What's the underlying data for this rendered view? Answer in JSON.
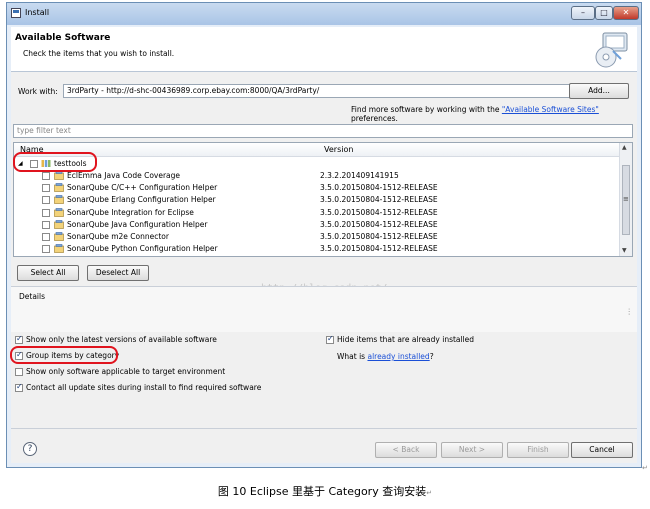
{
  "window": {
    "title": "Install",
    "min_glyph": "–",
    "max_glyph": "□",
    "close_glyph": "✕"
  },
  "header": {
    "title": "Available Software",
    "subtitle": "Check the items that you wish to install."
  },
  "work_with": {
    "label": "Work with:",
    "value": "3rdParty - http://d-shc-00436989.corp.ebay.com:8000/QA/3rdParty/",
    "dropdown_glyph": "▾",
    "add_label": "Add...",
    "more_prefix": "Find more software by working with the ",
    "more_link": "\"Available Software Sites\"",
    "more_suffix": " preferences."
  },
  "filter": {
    "placeholder": "type filter text"
  },
  "tree": {
    "col_name": "Name",
    "col_version": "Version",
    "group": {
      "label": "testtools",
      "expand_glyph": "◢"
    },
    "items": [
      {
        "name": "EclEmma Java Code Coverage",
        "version": "2.3.2.201409141915"
      },
      {
        "name": "SonarQube C/C++ Configuration Helper",
        "version": "3.5.0.20150804-1512-RELEASE"
      },
      {
        "name": "SonarQube Erlang Configuration Helper",
        "version": "3.5.0.20150804-1512-RELEASE"
      },
      {
        "name": "SonarQube Integration for Eclipse",
        "version": "3.5.0.20150804-1512-RELEASE"
      },
      {
        "name": "SonarQube Java Configuration Helper",
        "version": "3.5.0.20150804-1512-RELEASE"
      },
      {
        "name": "SonarQube m2e Connector",
        "version": "3.5.0.20150804-1512-RELEASE"
      },
      {
        "name": "SonarQube Python Configuration Helper",
        "version": "3.5.0.20150804-1512-RELEASE"
      }
    ],
    "scroll_up": "▲",
    "scroll_down": "▼",
    "scroll_grip": "≡"
  },
  "select_all": "Select All",
  "deselect_all": "Deselect All",
  "details": {
    "label": "Details",
    "scroll_glyph": "⋮"
  },
  "options": {
    "show_latest": "Show only the latest versions of available software",
    "group_by_category": "Group items by category",
    "target_env": "Show only software applicable to target environment",
    "contact_sites": "Contact all update sites during install to find required software",
    "hide_installed": "Hide items that are already installed",
    "what_is": "What is ",
    "already_installed": "already installed",
    "what_is_suffix": "?"
  },
  "buttons": {
    "help": "?",
    "back": "< Back",
    "next": "Next >",
    "finish": "Finish",
    "cancel": "Cancel"
  },
  "watermark": "http://blog.csdn.net/",
  "caption": "图 10   Eclipse 里基于 Category 查询安装",
  "caption_mark": "↵",
  "colors": {
    "accent_link": "#1a4fd6",
    "highlight_red": "#e0141e"
  }
}
